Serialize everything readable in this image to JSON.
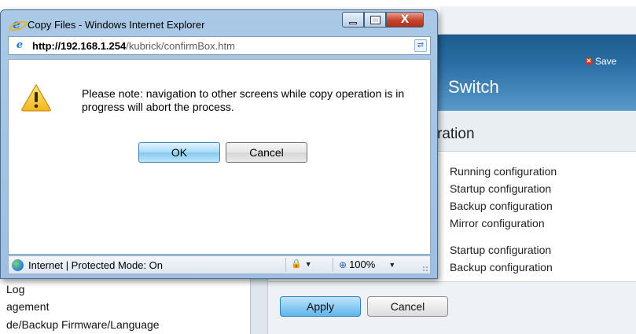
{
  "background": {
    "save_label": "Save",
    "header_title": "Switch",
    "page_title": "ration",
    "options": [
      "Running configuration",
      "Startup configuration",
      "Backup configuration",
      "Mirror configuration",
      "Startup configuration",
      "Backup configuration"
    ],
    "apply_label": "Apply",
    "cancel_label": "Cancel",
    "nav_items": [
      "Log",
      "agement",
      "de/Backup Firmware/Language"
    ]
  },
  "window": {
    "title": "Copy Files - Windows Internet Explorer",
    "close_glyph": "X",
    "address_host": "http://192.168.1.254",
    "address_path": "/kubrick/confirmBox.htm",
    "message": "Please note: navigation to other screens while copy operation is in progress will abort the process.",
    "ok_label": "OK",
    "cancel_label": "Cancel",
    "status_zone": "Internet | Protected Mode: On",
    "zoom_level": "100%"
  },
  "icons": {
    "title_icon": "ie-logo-icon",
    "address_icon": "ie-page-icon",
    "warning": "warning-icon",
    "globe": "globe-icon",
    "security": "security-icon",
    "zoom": "zoom-icon"
  },
  "colors": {
    "header_blue": "#2b6fa6",
    "ok_button": "#86c9f0",
    "warning_yellow": "#f3c623"
  }
}
